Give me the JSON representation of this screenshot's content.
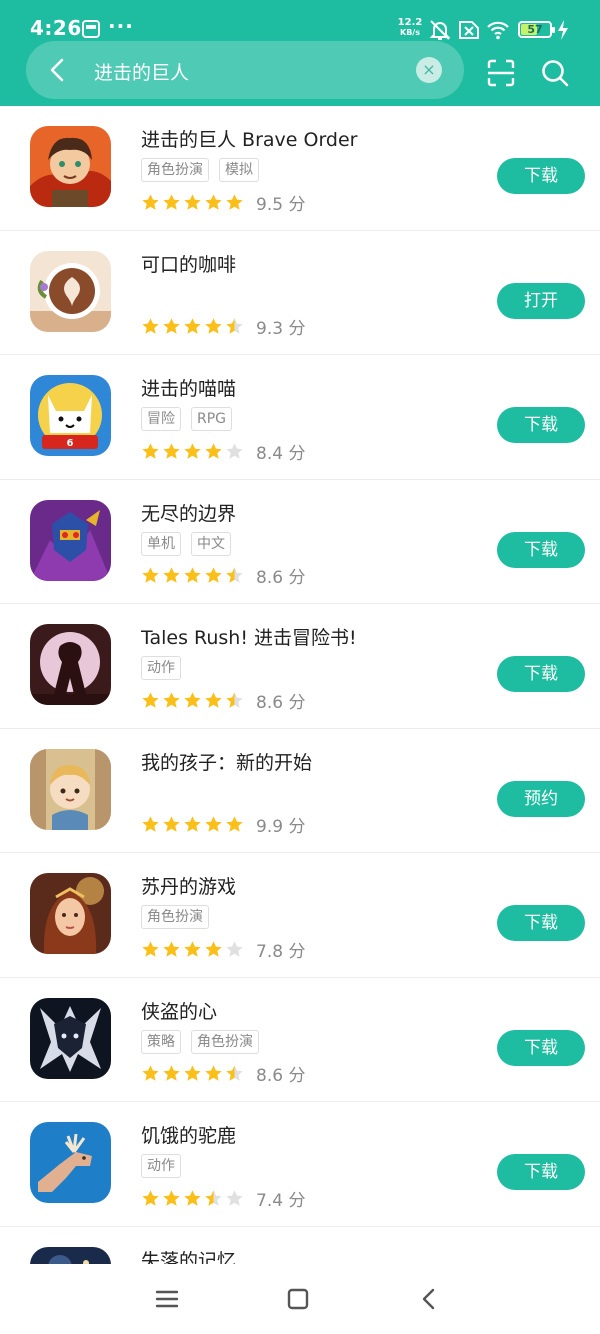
{
  "status_bar": {
    "time": "4:26",
    "more": "···",
    "net_speed_value": "12.2",
    "net_speed_unit": "KB/s",
    "battery_level": "57",
    "battery_fraction": 0.57,
    "icons": [
      "app-notification-icon",
      "mute-bell-icon",
      "sim-no-signal-icon",
      "wifi-icon",
      "battery-icon",
      "charging-icon"
    ]
  },
  "search": {
    "query": "进击的巨人",
    "clear_symbol": "×",
    "icons": [
      "back-arrow-icon",
      "clear-icon",
      "scan-icon",
      "search-icon"
    ]
  },
  "colors": {
    "accent": "#1ebca0",
    "star": "#fbbf1a",
    "star_empty": "#e0e0e0",
    "tag_text": "#8a8a8a"
  },
  "items": [
    {
      "name": "进击的巨人 Brave Order",
      "tags": [
        "角色扮演",
        "模拟"
      ],
      "stars": 5,
      "score": "9.5 分",
      "action": "下载"
    },
    {
      "name": "可口的咖啡",
      "tags": [],
      "stars": 4.5,
      "score": "9.3 分",
      "action": "打开"
    },
    {
      "name": "进击的喵喵",
      "tags": [
        "冒险",
        "RPG"
      ],
      "stars": 4,
      "score": "8.4 分",
      "action": "下载"
    },
    {
      "name": "无尽的边界",
      "tags": [
        "单机",
        "中文"
      ],
      "stars": 4.5,
      "score": "8.6 分",
      "action": "下载"
    },
    {
      "name": "Tales Rush! 进击冒险书!",
      "tags": [
        "动作"
      ],
      "stars": 4.5,
      "score": "8.6 分",
      "action": "下载"
    },
    {
      "name": "我的孩子：新的开始",
      "tags": [],
      "stars": 5,
      "score": "9.9 分",
      "action": "预约"
    },
    {
      "name": "苏丹的游戏",
      "tags": [
        "角色扮演"
      ],
      "stars": 4,
      "score": "7.8 分",
      "action": "下载"
    },
    {
      "name": "侠盗的心",
      "tags": [
        "策略",
        "角色扮演"
      ],
      "stars": 4.5,
      "score": "8.6 分",
      "action": "下载"
    },
    {
      "name": "饥饿的驼鹿",
      "tags": [
        "动作"
      ],
      "stars": 3.5,
      "score": "7.4 分",
      "action": "下载"
    },
    {
      "name": "失落的记忆",
      "tags": [],
      "stars": 0,
      "score": "",
      "action": ""
    }
  ],
  "navbar": {
    "icons": [
      "menu-icon",
      "home-icon",
      "back-icon"
    ]
  }
}
